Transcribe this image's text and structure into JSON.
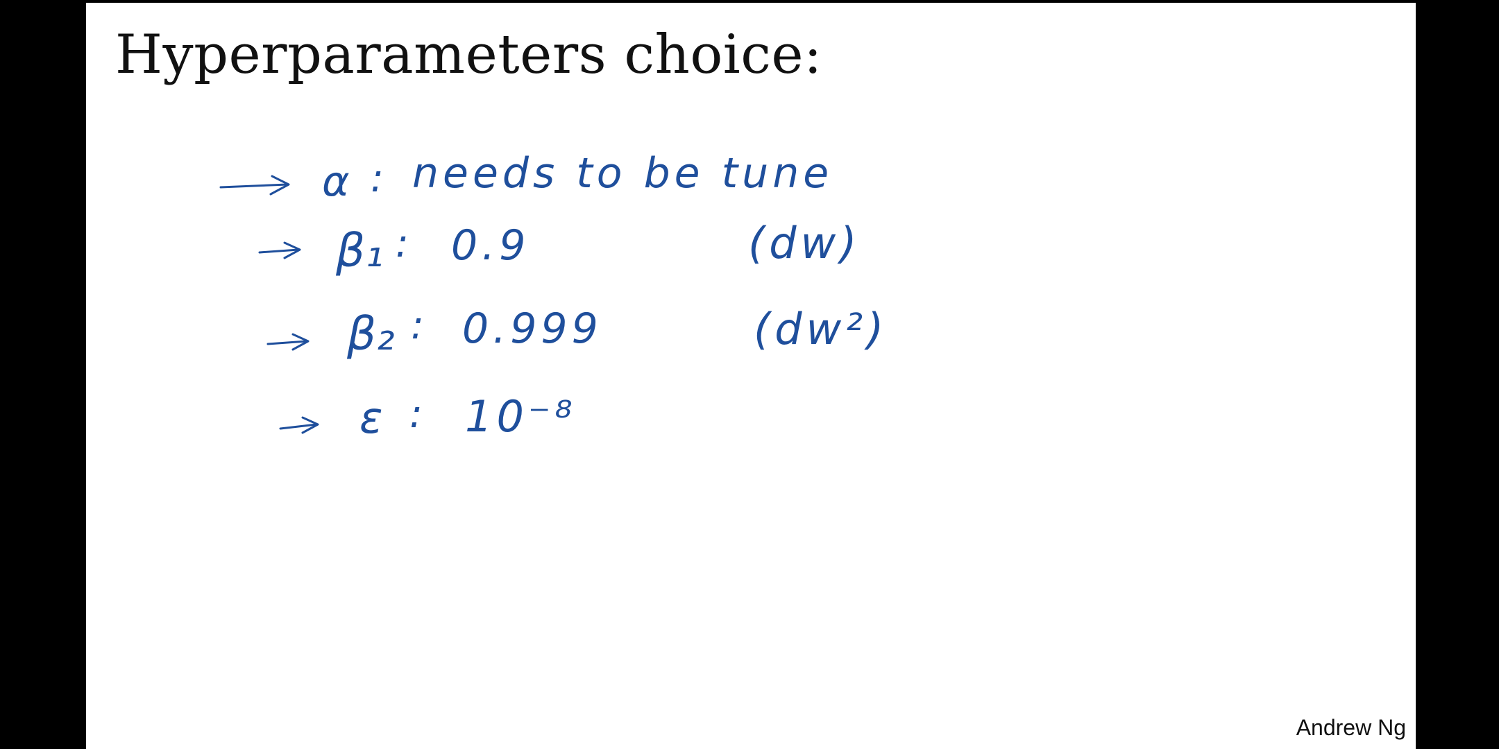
{
  "slide": {
    "title": "Hyperparameters choice:",
    "author": "Andrew Ng"
  },
  "notes": {
    "ink_color": "#1f4f9c",
    "lines": [
      {
        "symbol": "α",
        "colon": ":",
        "value": "needs to be tune",
        "annotation": ""
      },
      {
        "symbol": "β₁",
        "colon": ":",
        "value": "0.9",
        "annotation": "(dw)"
      },
      {
        "symbol": "β₂",
        "colon": ":",
        "value": "0.999",
        "annotation": "(dw²)"
      },
      {
        "symbol": "ε",
        "colon": ":",
        "value": "10⁻⁸",
        "annotation": ""
      }
    ]
  }
}
